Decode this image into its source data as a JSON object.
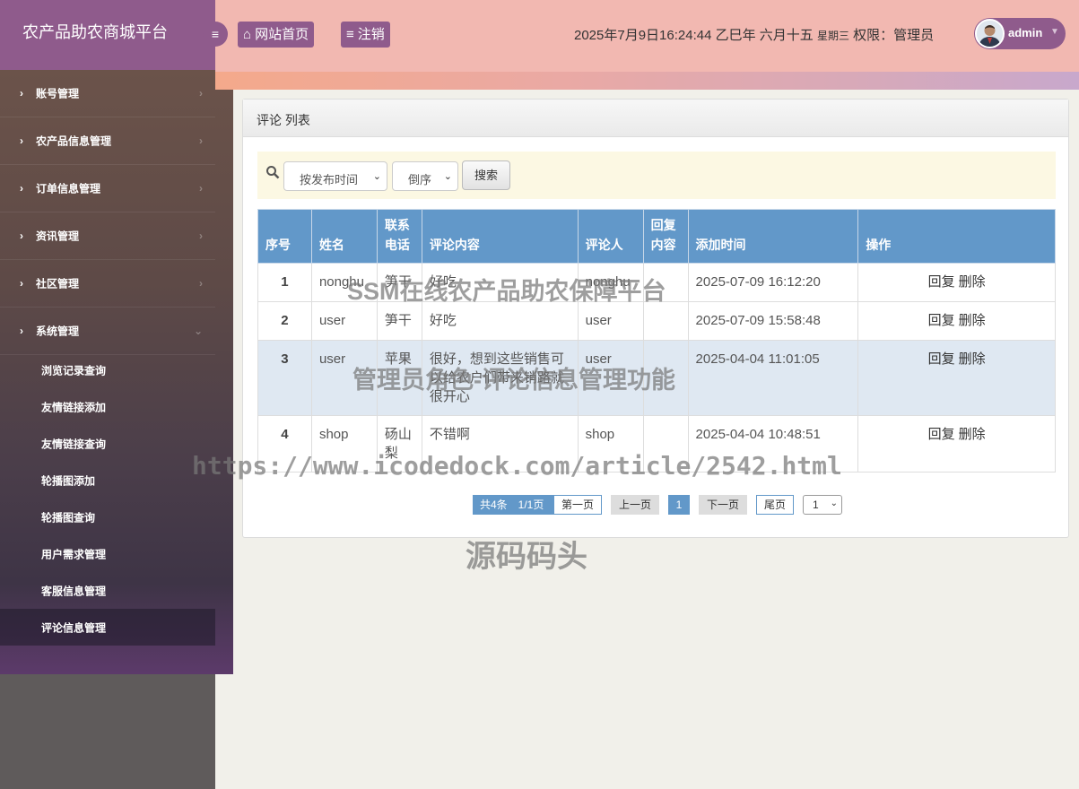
{
  "sidebar": {
    "title": "农产品助农商城平台",
    "menu": [
      {
        "label": "账号管理"
      },
      {
        "label": "农产品信息管理"
      },
      {
        "label": "订单信息管理"
      },
      {
        "label": "资讯管理"
      },
      {
        "label": "社区管理"
      },
      {
        "label": "系统管理"
      }
    ],
    "submenu": [
      {
        "label": "浏览记录查询"
      },
      {
        "label": "友情链接添加"
      },
      {
        "label": "友情链接查询"
      },
      {
        "label": "轮播图添加"
      },
      {
        "label": "轮播图查询"
      },
      {
        "label": "用户需求管理"
      },
      {
        "label": "客服信息管理"
      },
      {
        "label": "评论信息管理"
      }
    ]
  },
  "header": {
    "home_label": "网站首页",
    "logout_label": "注销",
    "datetime": "2025年7月9日16:24:44 乙巳年 六月十五",
    "weekday": "星期三",
    "permission": "权限：管理员",
    "username": "admin"
  },
  "panel": {
    "title": "评论 列表",
    "search": {
      "sort_field": "按发布时间",
      "sort_order": "倒序",
      "search_label": "搜索"
    },
    "table": {
      "headers": [
        "序号",
        "姓名",
        "联系电话",
        "评论内容",
        "评论人",
        "回复内容",
        "添加时间",
        "操作"
      ],
      "rows": [
        {
          "index": "1",
          "name": "nonghu",
          "phone": "笋干",
          "content": "好吃",
          "commenter": "nonghu",
          "reply": "",
          "time": "2025-07-09 16:12:20",
          "reply_action": "回复",
          "delete_action": "删除"
        },
        {
          "index": "2",
          "name": "user",
          "phone": "笋干",
          "content": "好吃",
          "commenter": "user",
          "reply": "",
          "time": "2025-07-09 15:58:48",
          "reply_action": "回复",
          "delete_action": "删除"
        },
        {
          "index": "3",
          "name": "user",
          "phone": "苹果",
          "content": "很好，想到这些销售可以给农户们带来销路就很开心",
          "commenter": "user",
          "reply": "",
          "time": "2025-04-04 11:01:05",
          "reply_action": "回复",
          "delete_action": "删除"
        },
        {
          "index": "4",
          "name": "shop",
          "phone": "砀山梨",
          "content": "不错啊",
          "commenter": "shop",
          "reply": "",
          "time": "2025-04-04 10:48:51",
          "reply_action": "回复",
          "delete_action": "删除"
        }
      ]
    },
    "pagination": {
      "info": "共4条　1/1页",
      "first": "第一页",
      "prev": "上一页",
      "current": "1",
      "next": "下一页",
      "last": "尾页",
      "page_select": "1"
    }
  },
  "watermarks": {
    "line1": "SSM在线农产品助农保障平台",
    "line2": "管理员角色-评论信息管理功能",
    "line3": "https://www.icodedock.com/article/2542.html",
    "line4": "源码码头"
  },
  "colors": {
    "sidebar_top": "#8f5b8c",
    "header_bg": "#f2b8b1",
    "table_header": "#6298c9",
    "search_bar": "#fcf8e3"
  }
}
